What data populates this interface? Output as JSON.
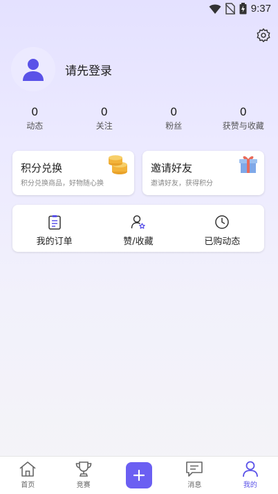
{
  "status": {
    "time": "9:37"
  },
  "profile": {
    "login_text": "请先登录"
  },
  "stats": [
    {
      "count": "0",
      "label": "动态"
    },
    {
      "count": "0",
      "label": "关注"
    },
    {
      "count": "0",
      "label": "粉丝"
    },
    {
      "count": "0",
      "label": "获赞与收藏"
    }
  ],
  "cards": {
    "points": {
      "title": "积分兑换",
      "subtitle": "积分兑换商品，好物随心换"
    },
    "invite": {
      "title": "邀请好友",
      "subtitle": "邀请好友，获得积分"
    }
  },
  "menu": [
    {
      "label": "我的订单",
      "icon": "clipboard-icon"
    },
    {
      "label": "赞/收藏",
      "icon": "user-star-icon"
    },
    {
      "label": "已购动态",
      "icon": "clock-icon"
    }
  ],
  "tabs": [
    {
      "label": "首页",
      "icon": "home-icon"
    },
    {
      "label": "竞赛",
      "icon": "trophy-icon"
    },
    {
      "label": "",
      "icon": "plus-icon"
    },
    {
      "label": "消息",
      "icon": "message-icon"
    },
    {
      "label": "我的",
      "icon": "user-icon"
    }
  ],
  "colors": {
    "accent": "#5a52e8",
    "plus_button": "#6b5ff2",
    "coin": "#f2b33a",
    "gift_box": "#7fa8e8",
    "gift_ribbon": "#e86a5a"
  }
}
